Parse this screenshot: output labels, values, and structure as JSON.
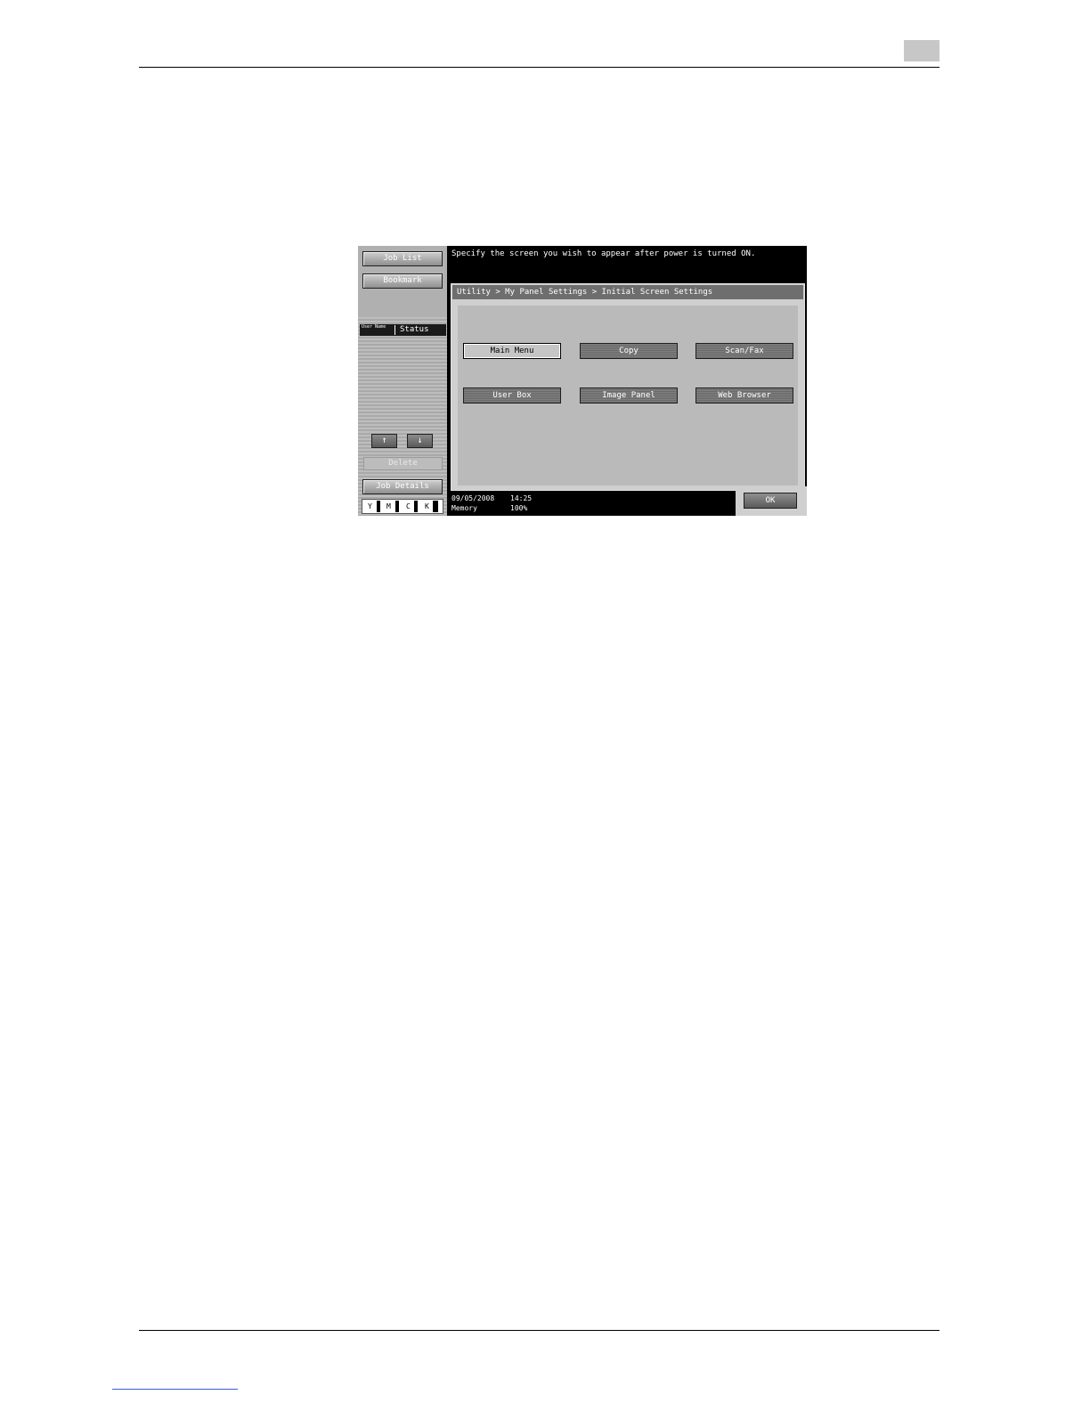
{
  "instruction": "Specify the screen you wish to appear after power is turned ON.",
  "breadcrumb": "Utility > My Panel Settings > Initial Screen Settings",
  "sidebar": {
    "job_list": "Job List",
    "bookmark": "Bookmark",
    "user_name": "User Name",
    "status": "Status",
    "up": "↑",
    "down": "↓",
    "delete": "Delete",
    "job_details": "Job Details"
  },
  "toner": {
    "y": "Y",
    "m": "M",
    "c": "C",
    "k": "K"
  },
  "options": {
    "main_menu": "Main Menu",
    "copy": "Copy",
    "scan_fax": "Scan/Fax",
    "user_box": "User Box",
    "image_panel": "Image Panel",
    "web_browser": "Web Browser"
  },
  "footer": {
    "date": "09/05/2008",
    "time": "14:25",
    "memory_label": "Memory",
    "memory_value": "100%"
  },
  "ok": "OK"
}
